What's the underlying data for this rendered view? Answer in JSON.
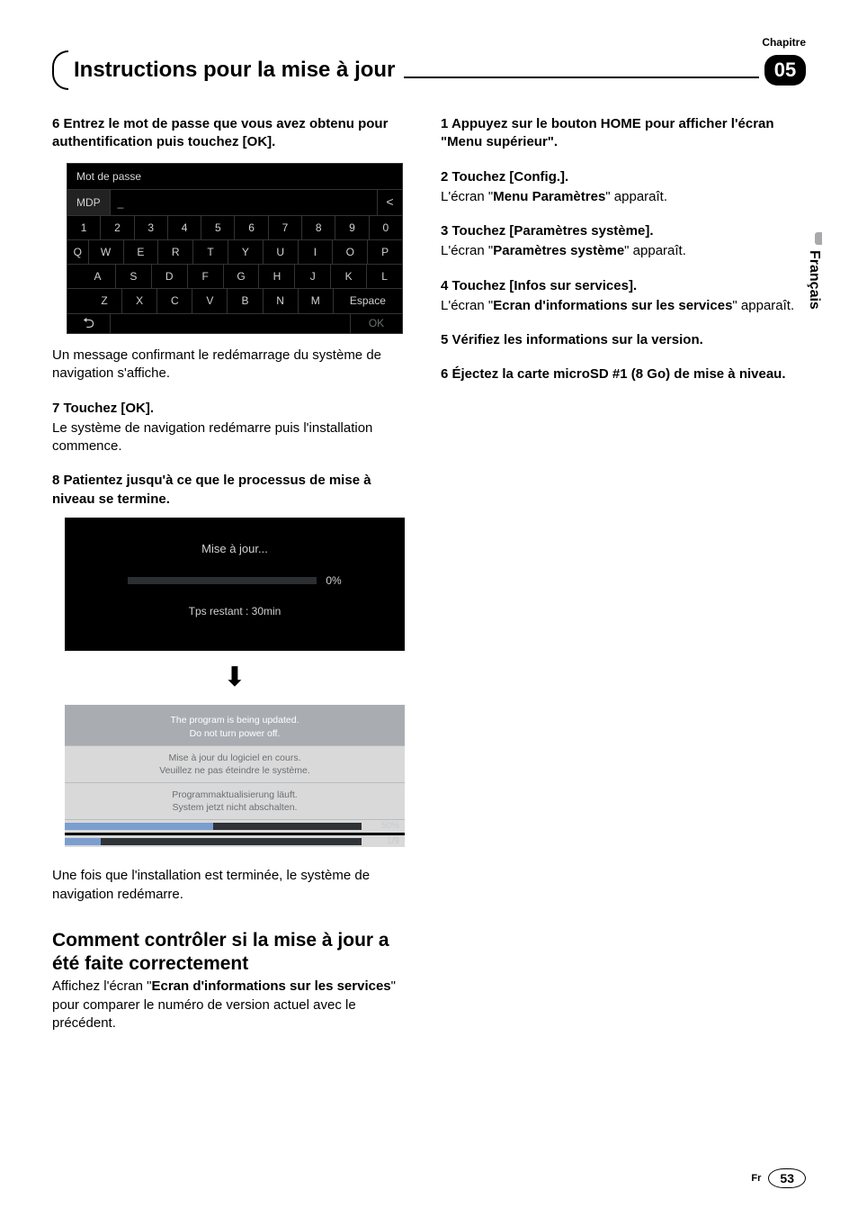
{
  "header": {
    "chapter_label": "Chapitre",
    "chapter_number": "05"
  },
  "title": "Instructions pour la mise à jour",
  "side_tab": "Français",
  "footer": {
    "lang": "Fr",
    "page": "53"
  },
  "left": {
    "step6": "6   Entrez le mot de passe que vous avez obtenu pour authentification puis touchez [OK].",
    "kb": {
      "title": "Mot de passe",
      "mdp": "MDP",
      "cursor": "_",
      "backspace": "<",
      "row1": [
        "1",
        "2",
        "3",
        "4",
        "5",
        "6",
        "7",
        "8",
        "9",
        "0"
      ],
      "row2": [
        "Q",
        "W",
        "E",
        "R",
        "T",
        "Y",
        "U",
        "I",
        "O",
        "P"
      ],
      "row3": [
        "A",
        "S",
        "D",
        "F",
        "G",
        "H",
        "J",
        "K",
        "L"
      ],
      "row4": [
        "Z",
        "X",
        "C",
        "V",
        "B",
        "N",
        "M"
      ],
      "space": "Espace",
      "return": "⮌",
      "ok": "OK"
    },
    "after_kb": "Un message confirmant le redémarrage du système de navigation s'affiche.",
    "step7_head": "7   Touchez [OK].",
    "step7_body": "Le système de navigation redémarre puis l'installation commence.",
    "step8": "8   Patientez jusqu'à ce que le processus de mise à niveau se termine.",
    "prog1": {
      "title": "Mise à jour...",
      "percent": "0%",
      "remaining": "Tps restant : 30min"
    },
    "arrow": "⬇",
    "prog2": {
      "en1": "The program is being updated.",
      "en2": "Do not turn power off.",
      "fr1": "Mise à jour du logiciel en cours.",
      "fr2": "Veuillez ne pas éteindre le système.",
      "de1": "Programmaktualisierung läuft.",
      "de2": "System jetzt nicht abschalten.",
      "pct1": "50%",
      "pct2": "1/9"
    },
    "after_prog": "Une fois que l'installation est terminée, le système de navigation redémarre.",
    "section_heading": "Comment contrôler si la mise à jour a été faite correctement",
    "section_body_a": "Affichez l'écran \"",
    "section_body_b": "Ecran d'informations sur les services",
    "section_body_c": "\" pour comparer le numéro de version actuel avec le précédent."
  },
  "right": {
    "step1": "1   Appuyez sur le bouton HOME pour afficher l'écran \"Menu supérieur\".",
    "step2_head": "2   Touchez [Config.].",
    "step2_body_a": "L'écran \"",
    "step2_body_b": "Menu Paramètres",
    "step2_body_c": "\" apparaît.",
    "step3_head": "3   Touchez [Paramètres système].",
    "step3_body_a": "L'écran \"",
    "step3_body_b": "Paramètres système",
    "step3_body_c": "\" apparaît.",
    "step4_head": "4   Touchez [Infos sur services].",
    "step4_body_a": "L'écran \"",
    "step4_body_b": "Ecran d'informations sur les services",
    "step4_body_c": "\" apparaît.",
    "step5": "5   Vérifiez les informations sur la version.",
    "step6": "6   Éjectez la carte microSD #1 (8 Go) de mise à niveau."
  }
}
